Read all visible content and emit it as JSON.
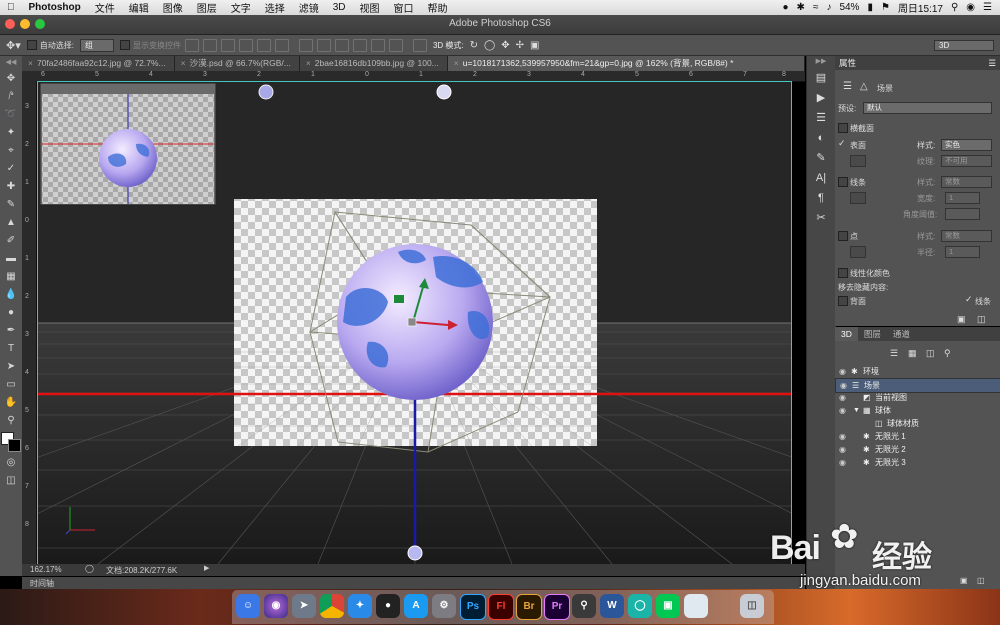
{
  "menubar": {
    "app_name": "Photoshop",
    "items": [
      "文件",
      "编辑",
      "图像",
      "图层",
      "文字",
      "选择",
      "滤镜",
      "3D",
      "视图",
      "窗口",
      "帮助"
    ],
    "battery": "54%",
    "datetime": "周日15:17"
  },
  "window": {
    "title": "Adobe Photoshop CS6"
  },
  "options_bar": {
    "auto_select_label": "自动选择:",
    "auto_select_value": "组",
    "show_transform_label": "显示变换控件",
    "mode_3d_label": "3D 模式:",
    "workspace": "3D"
  },
  "tabs": [
    {
      "label": "70fa2486faa92c12.jpg @ 72.7%...",
      "active": false
    },
    {
      "label": "沙漠.psd @ 66.7%(RGB/...",
      "active": false
    },
    {
      "label": "2bae16816db109bb.jpg @ 100...",
      "active": false
    },
    {
      "label": "u=1018171362,539957950&fm=21&gp=0.jpg @ 162% (背景, RGB/8#) *",
      "active": true
    }
  ],
  "rulers": {
    "h": [
      "6",
      "5",
      "4",
      "3",
      "2",
      "1",
      "0",
      "1",
      "2",
      "3",
      "4",
      "5",
      "6",
      "7",
      "8",
      "9"
    ],
    "v": [
      "3",
      "2",
      "1",
      "0",
      "1",
      "2",
      "3",
      "4",
      "5",
      "6",
      "7",
      "8",
      "1"
    ]
  },
  "status": {
    "zoom": "162.17%",
    "doc": "文档:208.2K/277.6K"
  },
  "timeline": {
    "label": "时间轴"
  },
  "properties": {
    "header": "属性",
    "scene_label": "场景",
    "preset_label": "预设:",
    "preset_value": "默认",
    "cross_section_label": "横截面",
    "surface_label": "表面",
    "surface_checked": true,
    "style_label": "样式:",
    "surface_style": "实色",
    "texture_label": "纹理:",
    "texture_value": "不可用",
    "lines_label": "线条",
    "lines_style": "常数",
    "width_label": "宽度:",
    "width_value": "1",
    "angle_label": "角度阈值:",
    "points_label": "点",
    "points_style": "常数",
    "radius_label": "半径:",
    "radius_value": "1",
    "linearize_label": "线性化颜色",
    "remove_hidden_label": "移去隐藏内容:",
    "back_label": "背面",
    "lines2_label": "线条"
  },
  "panel3d": {
    "tabs": [
      "3D",
      "图层",
      "通道"
    ],
    "layers": [
      {
        "label": "环境",
        "selected": false,
        "indent": 0
      },
      {
        "label": "场景",
        "selected": true,
        "indent": 0
      },
      {
        "label": "当前视图",
        "selected": false,
        "indent": 1
      },
      {
        "label": "球体",
        "selected": false,
        "indent": 1
      },
      {
        "label": "球体材质",
        "selected": false,
        "indent": 2
      },
      {
        "label": "无限光 1",
        "selected": false,
        "indent": 1
      },
      {
        "label": "无限光 2",
        "selected": false,
        "indent": 1
      },
      {
        "label": "无限光 3",
        "selected": false,
        "indent": 1
      }
    ]
  },
  "watermark": {
    "brand": "Bai",
    "brand2": "经验",
    "url": "jingyan.baidu.com"
  },
  "dock": {
    "ps": "Ps",
    "fl": "Fl",
    "br": "Br",
    "pr": "Pr",
    "w": "W"
  }
}
